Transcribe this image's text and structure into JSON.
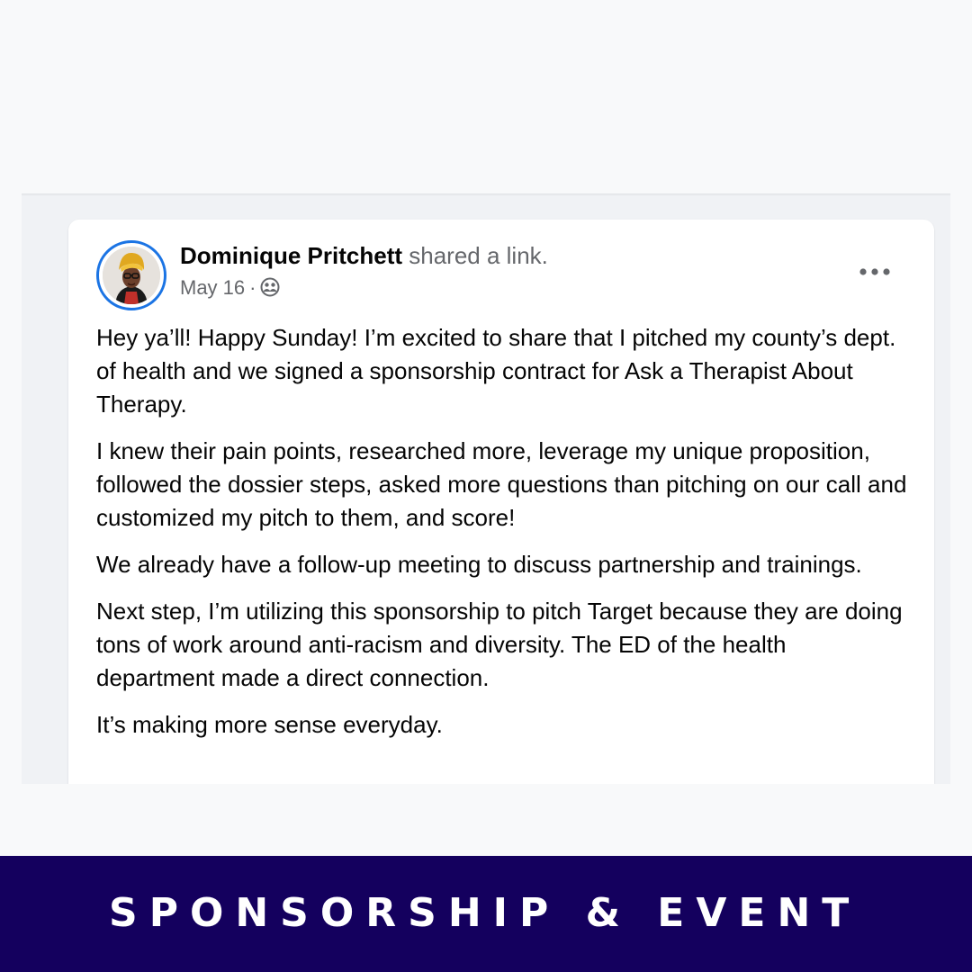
{
  "post": {
    "author": "Dominique Pritchett",
    "action": "shared a link.",
    "date": "May 16",
    "separator": "·",
    "audience_icon": "friends-icon",
    "more_icon": "more-options-icon",
    "paragraphs": [
      "Hey ya’ll! Happy Sunday! I’m excited to share that I pitched my county’s dept. of health and we signed a sponsorship contract for Ask a Therapist About Therapy.",
      "I knew their pain points, researched more, leverage my unique proposition, followed the dossier steps, asked more questions than pitching on our call and customized my pitch to them, and score!",
      "We already have a follow-up meeting to discuss partnership and trainings.",
      "Next step, I’m utilizing this sponsorship to pitch Target because they are doing tons of work around anti-racism and diversity. The ED of the health department made a direct connection.",
      "It’s making more sense everyday."
    ]
  },
  "banner": {
    "text": "SPONSORSHIP & EVENT"
  },
  "colors": {
    "banner_bg": "#14005e",
    "avatar_ring": "#1b74e4",
    "card_bg": "#ffffff",
    "feed_bg": "#f0f2f5"
  }
}
